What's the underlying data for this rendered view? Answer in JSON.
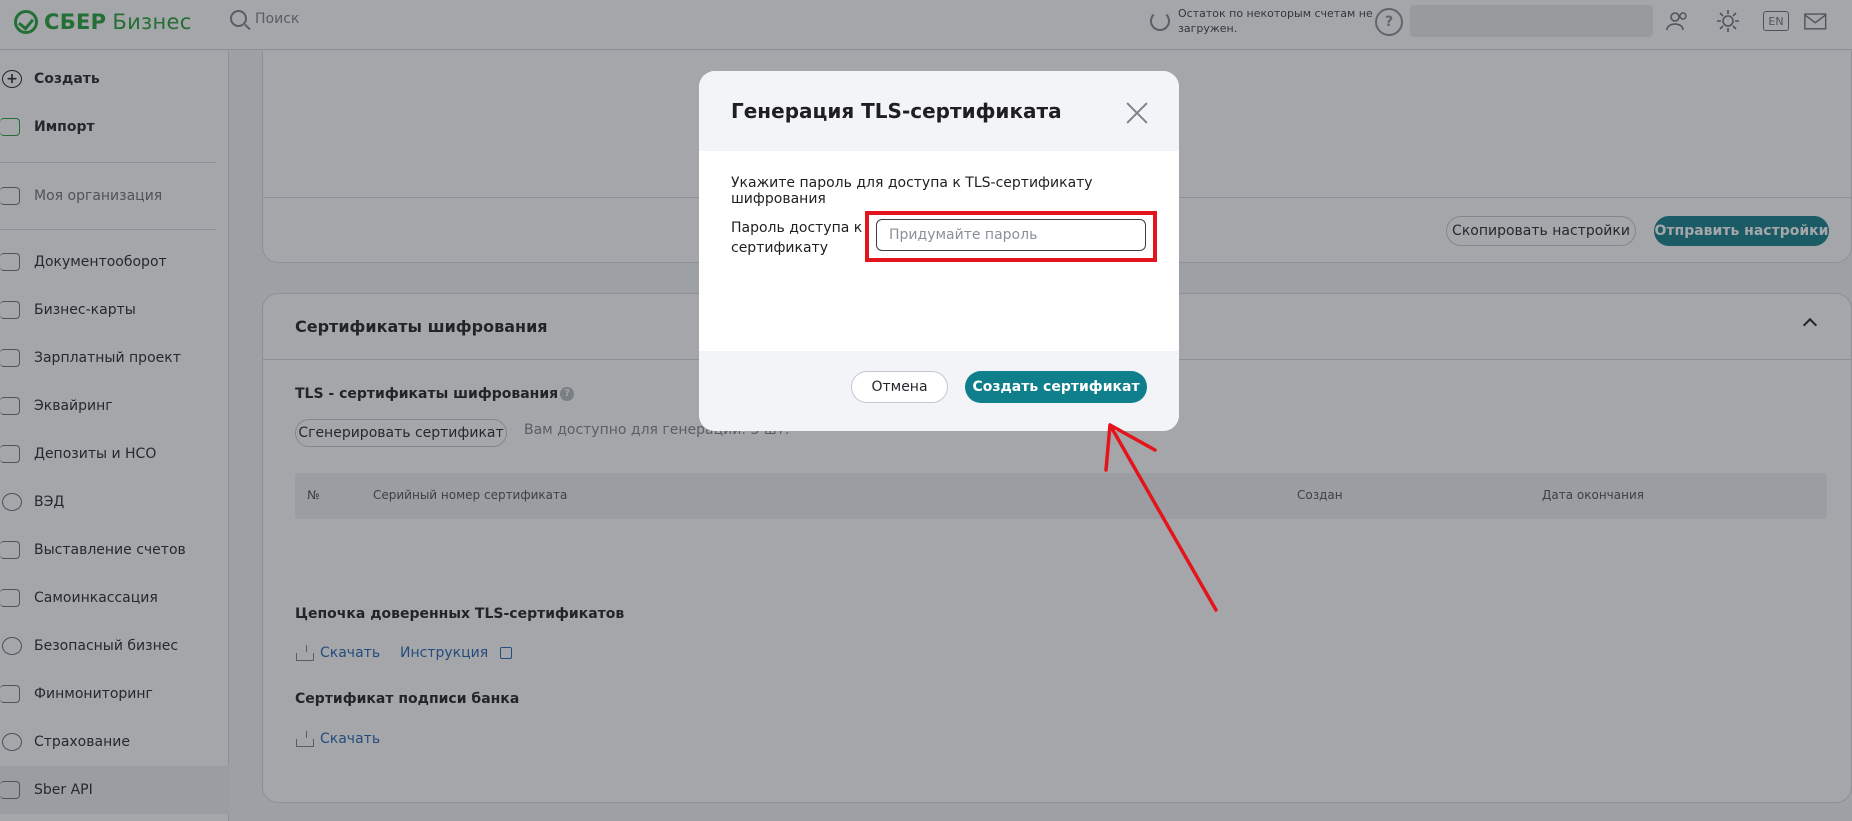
{
  "header": {
    "logo_brand": "СБЕР",
    "logo_product": "Бизнес",
    "search_placeholder": "Поиск",
    "balance_notice": "Остаток по некоторым счетам не загружен.",
    "help_glyph": "?",
    "lang": "EN",
    "icons": [
      "logo-icon",
      "search-icon",
      "refresh-icon",
      "help-icon",
      "users-icon",
      "theme-icon",
      "lang-icon",
      "mail-icon"
    ]
  },
  "sidebar": {
    "items": [
      {
        "label": "Создать",
        "icon": "plus-icon"
      },
      {
        "label": "Импорт",
        "icon": "import-icon"
      },
      {
        "label": "Моя организация",
        "icon": "organization-icon"
      },
      {
        "label": "Документооборот",
        "icon": "documents-icon"
      },
      {
        "label": "Бизнес-карты",
        "icon": "card-icon"
      },
      {
        "label": "Зарплатный проект",
        "icon": "wallet-icon"
      },
      {
        "label": "Эквайринг",
        "icon": "acquiring-icon"
      },
      {
        "label": "Депозиты и НСО",
        "icon": "deposit-icon"
      },
      {
        "label": "ВЭД",
        "icon": "globe-icon"
      },
      {
        "label": "Выставление счетов",
        "icon": "invoice-icon"
      },
      {
        "label": "Самоинкассация",
        "icon": "cash-icon"
      },
      {
        "label": "Безопасный бизнес",
        "icon": "secure-icon"
      },
      {
        "label": "Финмониторинг",
        "icon": "monitoring-icon"
      },
      {
        "label": "Страхование",
        "icon": "shield-icon"
      },
      {
        "label": "Sber API",
        "icon": "api-icon"
      }
    ]
  },
  "settings_card": {
    "copy_button": "Скопировать настройки",
    "send_button": "Отправить настройки"
  },
  "certs_card": {
    "title": "Сертификаты шифрования",
    "tls_title": "TLS - сертификаты шифрования",
    "tls_info": "?",
    "generate_button": "Сгенерировать сертификат",
    "available_text": "Вам доступно для генерации: 3 шт.",
    "table_headers": {
      "num": "№",
      "serial": "Серийный номер сертификата",
      "created": "Создан",
      "expires": "Дата окончания"
    },
    "chain_title": "Цепочка доверенных TLS-сертификатов",
    "download_label": "Скачать",
    "instruction_label": "Инструкция",
    "bank_sign_title": "Сертификат подписи банка",
    "download_label_2": "Скачать"
  },
  "modal": {
    "title": "Генерация TLS-сертификата",
    "description": "Укажите пароль для доступа к TLS-сертификату шифрования",
    "field_label": "Пароль доступа к сертификату",
    "field_placeholder": "Придумайте пароль",
    "field_value": "",
    "cancel_button": "Отмена",
    "create_button": "Создать сертификат"
  },
  "annotation": {
    "color": "#e3141b"
  },
  "colors": {
    "brand_green": "#21a038",
    "accent_teal": "#107f8c",
    "link_blue": "#2264b5"
  }
}
